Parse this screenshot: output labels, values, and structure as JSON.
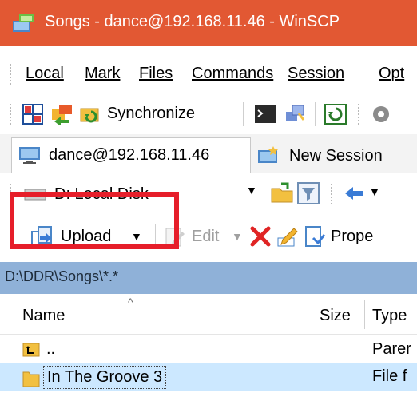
{
  "window": {
    "title": "Songs - dance@192.168.11.46 - WinSCP",
    "accent": "#e25833"
  },
  "menu": {
    "items": [
      "Local",
      "Mark",
      "Files",
      "Commands",
      "Session",
      "Opt"
    ]
  },
  "toolbar": {
    "synchronize_label": "Synchronize"
  },
  "tabs": {
    "active": "dance@192.168.11.46",
    "new_session": "New Session"
  },
  "local_pane": {
    "drive": "D: Local Disk",
    "upload_label": "Upload",
    "edit_label": "Edit",
    "properties_label": "Prope",
    "path": "D:\\DDR\\Songs\\*.*"
  },
  "file_list": {
    "columns": [
      "Name",
      "Size",
      "Type"
    ],
    "rows": [
      {
        "name": "..",
        "type": "Parer"
      },
      {
        "name": "In The Groove 3",
        "type": "File f"
      }
    ]
  },
  "highlight_color": "#e61e2a"
}
